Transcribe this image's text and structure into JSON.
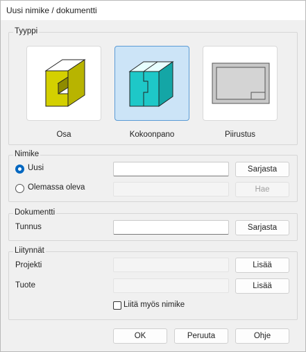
{
  "window": {
    "title": "Uusi nimike / dokumentti"
  },
  "tyyppi": {
    "label": "Tyyppi",
    "options": [
      {
        "label": "Osa",
        "icon": "part-icon",
        "selected": false
      },
      {
        "label": "Kokoonpano",
        "icon": "assembly-icon",
        "selected": true
      },
      {
        "label": "Piirustus",
        "icon": "drawing-icon",
        "selected": false
      }
    ]
  },
  "nimike": {
    "label": "Nimike",
    "uusi": {
      "label": "Uusi",
      "selected": true,
      "value": "",
      "button": "Sarjasta"
    },
    "olemassa": {
      "label": "Olemassa oleva",
      "selected": false,
      "value": "",
      "button": "Hae"
    }
  },
  "dokumentti": {
    "label": "Dokumentti",
    "tunnus": {
      "label": "Tunnus",
      "value": "",
      "button": "Sarjasta"
    }
  },
  "liitynnat": {
    "label": "Liitynnät",
    "projekti": {
      "label": "Projekti",
      "value": "",
      "button": "Lisää"
    },
    "tuote": {
      "label": "Tuote",
      "value": "",
      "button": "Lisää"
    },
    "checkbox": {
      "label": "Liitä myös nimike",
      "checked": false
    }
  },
  "footer": {
    "ok": "OK",
    "cancel": "Peruuta",
    "help": "Ohje"
  },
  "colors": {
    "part_yellow": "#d4d000",
    "assembly_cyan": "#1ec8c8",
    "selection_bg": "#cce4f7",
    "accent": "#0067c0"
  }
}
